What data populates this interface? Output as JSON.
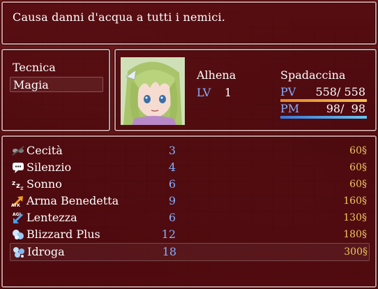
{
  "help": {
    "text": "Causa danni d'acqua a tutti i nemici."
  },
  "commands": [
    {
      "label": "Tecnica",
      "selected": false
    },
    {
      "label": "Magia",
      "selected": true
    }
  ],
  "actor": {
    "name": "Alhena",
    "class": "Spadaccina",
    "level_label": "LV",
    "level": "1",
    "hp": {
      "label": "PV",
      "text": "558/ 558",
      "ratio": 1.0
    },
    "mp": {
      "label": "PM",
      "text": "98/  98",
      "ratio": 1.0
    }
  },
  "skills": [
    {
      "name": "Cecità",
      "count": "3",
      "cost": "60§",
      "icon": "blind-icon"
    },
    {
      "name": "Silenzio",
      "count": "4",
      "cost": "60§",
      "icon": "silence-icon"
    },
    {
      "name": "Sonno",
      "count": "6",
      "cost": "60§",
      "icon": "sleep-icon"
    },
    {
      "name": "Arma Benedetta",
      "count": "9",
      "cost": "160§",
      "icon": "attack-up-icon"
    },
    {
      "name": "Lentezza",
      "count": "6",
      "cost": "130§",
      "icon": "agility-down-icon"
    },
    {
      "name": "Blizzard Plus",
      "count": "12",
      "cost": "180§",
      "icon": "ice-icon"
    },
    {
      "name": "Idroga",
      "count": "18",
      "cost": "300§",
      "icon": "water-icon",
      "selected": true
    }
  ],
  "colors": {
    "system_blue": "#84b0ff",
    "cost_gold": "#f0c860",
    "hp": "#e8a23a",
    "mp": "#4a9ee0"
  }
}
